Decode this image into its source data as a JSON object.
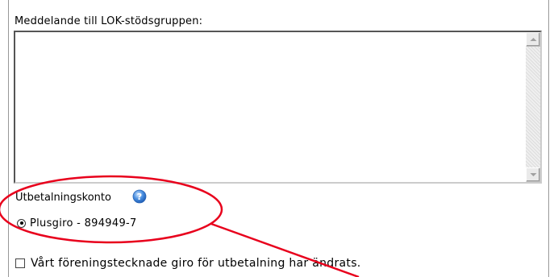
{
  "message": {
    "label": "Meddelande till LOK-stödsgruppen:",
    "value": ""
  },
  "payout": {
    "label": "Utbetalningskonto",
    "help_icon": "help-icon",
    "options": [
      {
        "label": "Plusgiro - 894949-7",
        "selected": true
      }
    ]
  },
  "changed_checkbox": {
    "label": "Vårt föreningstecknade giro för utbetalning har ändrats.",
    "checked": false
  },
  "annotation": {
    "color": "#e8001c"
  }
}
